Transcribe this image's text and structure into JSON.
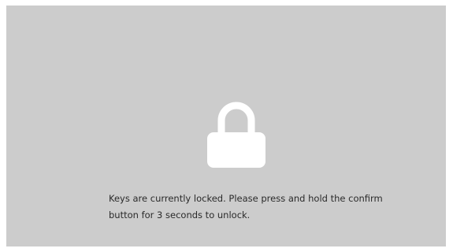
{
  "lock_screen": {
    "icon": "padlock-icon",
    "icon_color": "#ffffff",
    "background_color": "#cccccc",
    "message_line1": "Keys are currently locked. Please press and hold the confirm",
    "message_line2": "button for 3 seconds to unlock."
  }
}
